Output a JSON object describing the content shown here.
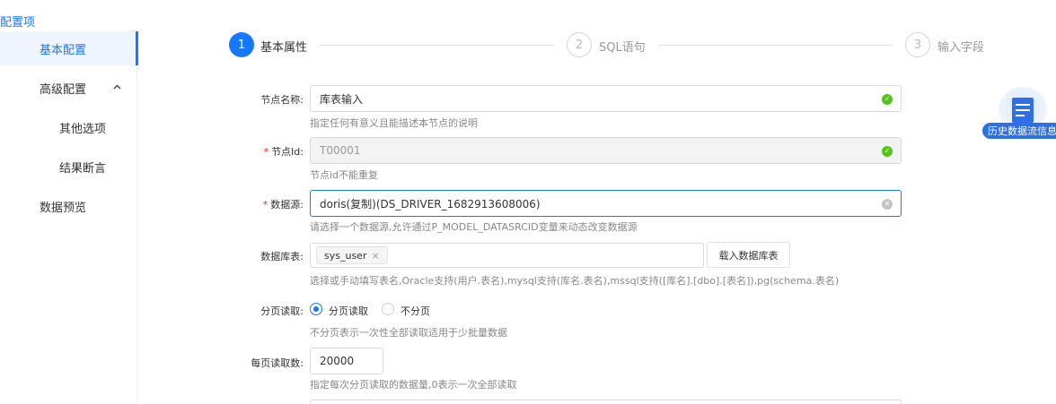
{
  "sidebar": {
    "title": "配置项",
    "items": [
      {
        "label": "基本配置"
      },
      {
        "label": "高级配置",
        "caret": "^"
      },
      {
        "label": "其他选项"
      },
      {
        "label": "结果断言"
      },
      {
        "label": "数据预览"
      }
    ]
  },
  "steps": [
    {
      "number": "1",
      "label": "基本属性",
      "state": "active"
    },
    {
      "number": "2",
      "label": "SQL语句",
      "state": "inactive"
    },
    {
      "number": "3",
      "label": "输入字段",
      "state": "inactive"
    }
  ],
  "form": {
    "node_name": {
      "label": "节点名称:",
      "value": "库表输入",
      "hint": "指定任何有意义且能描述本节点的说明",
      "status_icon": "check-circle-icon"
    },
    "node_id": {
      "required_mark": "*",
      "label": "节点Id:",
      "value": "T00001",
      "hint": "节点id不能重复",
      "status_icon": "check-circle-icon"
    },
    "datasource": {
      "required_mark": "*",
      "label": "数据源:",
      "value": "doris(复制)(DS_DRIVER_1682913608006)",
      "hint": "请选择一个数据源,允许通过P_MODEL_DATASRCID变量来动态改变数据源",
      "clear_icon": "clear-circle-icon"
    },
    "db_table": {
      "label": "数据库表:",
      "tag": "sys_user",
      "tag_close": "×",
      "load_button": "载入数据库表",
      "hint": "选择或手动填写表名,Oracle支持(用户.表名),mysql支持(库名.表名),mssql支持([库名].[dbo].[表名]),pg(schema.表名)"
    },
    "paging": {
      "label": "分页读取:",
      "options": [
        "分页读取",
        "不分页"
      ],
      "selected": "分页读取",
      "hint": "不分页表示一次性全部读取适用于少批量数据"
    },
    "page_size": {
      "label": "每页读取数:",
      "value": "20000",
      "hint": "指定每次分页读取的数据量,0表示一次全部读取"
    }
  },
  "floating": {
    "label": "历史数据流信息",
    "icon": "document-icon"
  },
  "colors": {
    "accent": "#1677ff",
    "success": "#52c41a",
    "required": "#f5222d"
  }
}
